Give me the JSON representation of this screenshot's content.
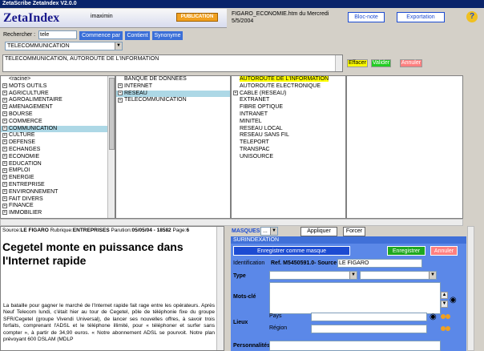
{
  "window": {
    "title": "ZetaScribe ZetaIndex V2.0.0"
  },
  "header": {
    "logo": "ZetaIndex",
    "user": "imaximin",
    "publication": "PUBLICATION",
    "file_line1": "FIGARO_ECONOMIE.htm du Mercredi",
    "file_line2": "5/5/2004",
    "bloc_note": "Bloc-note",
    "exportation": "Exportation",
    "help": "?"
  },
  "search": {
    "label": "Rechercher :",
    "value": "tele",
    "commence": "Commence par",
    "contient": "Contient",
    "synonyme": "Synonyme",
    "select": "TELECOMMUNICATION"
  },
  "selection": {
    "text": "TELECOMMUNICATION, AUTOROUTE DE L'INFORMATION",
    "effacer": "Effacer",
    "valider": "Valider",
    "annuler": "Annuler"
  },
  "tree1": [
    {
      "t": "<racine>",
      "p": false
    },
    {
      "t": "MOTS OUTILS",
      "p": true
    },
    {
      "t": "AGRICULTURE",
      "p": true
    },
    {
      "t": "AGROALIMENTAIRE",
      "p": true
    },
    {
      "t": "AMENAGEMENT",
      "p": true
    },
    {
      "t": "BOURSE",
      "p": true
    },
    {
      "t": "COMMERCE",
      "p": true
    },
    {
      "t": "COMMUNICATION",
      "p": true,
      "hl": true
    },
    {
      "t": "CULTURE",
      "p": true
    },
    {
      "t": "DEFENSE",
      "p": true
    },
    {
      "t": "ECHANGES",
      "p": true
    },
    {
      "t": "ECONOMIE",
      "p": true
    },
    {
      "t": "EDUCATION",
      "p": true
    },
    {
      "t": "EMPLOI",
      "p": true
    },
    {
      "t": "ENERGIE",
      "p": true
    },
    {
      "t": "ENTREPRISE",
      "p": true
    },
    {
      "t": "ENVIRONNEMENT",
      "p": true
    },
    {
      "t": "FAIT DIVERS",
      "p": true
    },
    {
      "t": "FINANCE",
      "p": true
    },
    {
      "t": "IMMOBILIER",
      "p": true
    }
  ],
  "tree2": [
    {
      "t": "BANQUE DE DONNEES",
      "p": false
    },
    {
      "t": "INTERNET",
      "p": true
    },
    {
      "t": "RESEAU",
      "p": true,
      "hl": true
    },
    {
      "t": "TELECOMMUNICATION",
      "p": true
    }
  ],
  "tree3": [
    {
      "t": "AUTOROUTE DE L'INFORMATION",
      "p": false,
      "y": true
    },
    {
      "t": "AUTOROUTE ELECTRONIQUE",
      "p": false
    },
    {
      "t": "CABLE (RESEAU)",
      "p": true
    },
    {
      "t": "EXTRANET",
      "p": false
    },
    {
      "t": "FIBRE OPTIQUE",
      "p": false
    },
    {
      "t": "INTRANET",
      "p": false
    },
    {
      "t": "MINITEL",
      "p": false
    },
    {
      "t": "RESEAU LOCAL",
      "p": false
    },
    {
      "t": "RESEAU SANS FIL",
      "p": false
    },
    {
      "t": "TELEPORT",
      "p": false
    },
    {
      "t": "TRANSPAC",
      "p": false
    },
    {
      "t": "UNISOURCE",
      "p": false
    }
  ],
  "article": {
    "source_prefix": "Source:",
    "source": "LE FIGARO",
    "rubrique_prefix": "Rubrique:",
    "rubrique": "ENTREPRISES",
    "parution_prefix": "Parution:",
    "parution": "05/05/04 - 18582",
    "page_prefix": "Page:",
    "page": "6",
    "headline": "Cegetel monte en puissance dans l'Internet rapide",
    "body1": "La bataille pour gagner le marché de l'Internet rapide fait rage entre les opérateurs. Après Neuf Telecom lundi, c'était hier au tour de Cegetel, pôle de téléphonie fixe du groupe SFR/Cegetel (groupe Vivendi Universal), de lancer ses nouvelles offres, à savoir trois forfaits, comprenant l'ADSL et le téléphone illimité, pour « téléphoner et surfer sans compter », à partir de 34,90 euros. « Notre abonnement ADSL se pourvoit. Notre plan prévoyant 600 DSLAM (MDLP"
  },
  "form": {
    "masques": "MASQUES",
    "masque_sel": "...",
    "appliquer": "Appliquer",
    "forcer": "Forcer",
    "surindexation": "SURINDEXATION",
    "enreg_masque": "Enregistrer comme masque",
    "enregistrer": "Enregistrer",
    "annuler": "Annuler",
    "identification": "Identification",
    "ref": "Ref. M5450591.0- Source",
    "source_val": "LE FIGARO",
    "type": "Type",
    "motscle": "Mots-clé",
    "lieux": "Lieux",
    "pays": "Pays",
    "region": "Région",
    "personnalites": "Personnalités"
  }
}
